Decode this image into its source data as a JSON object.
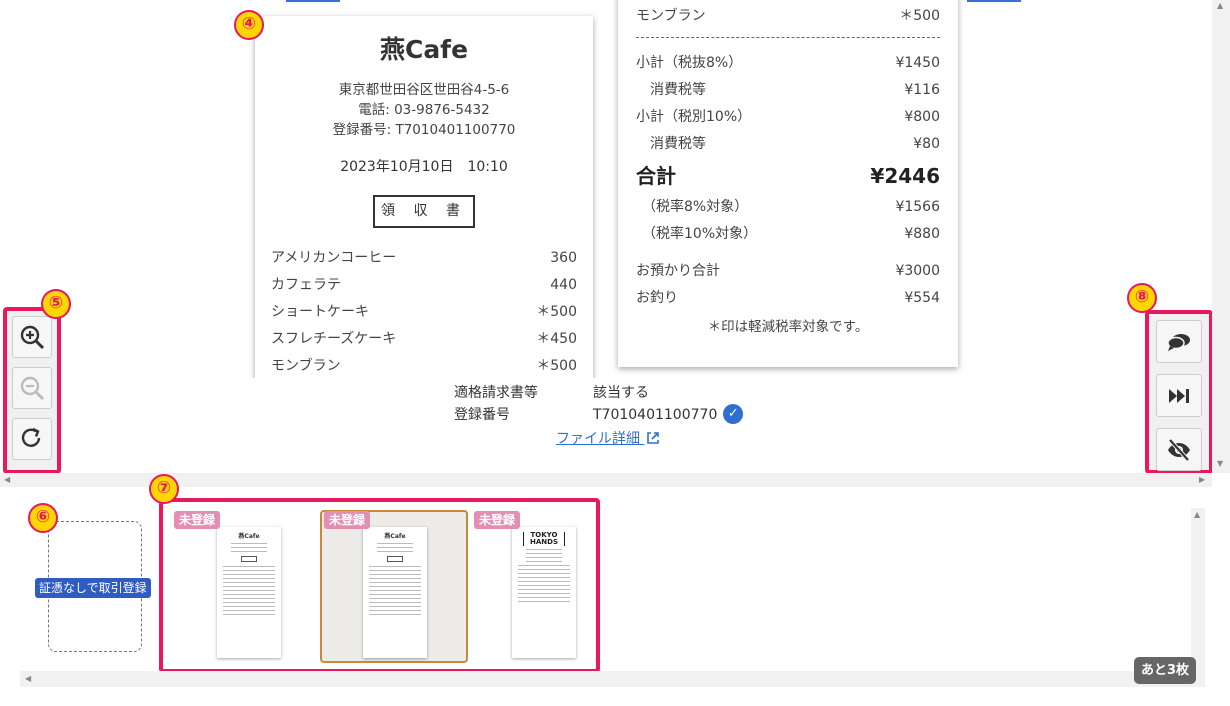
{
  "receipt_left": {
    "shop_name": "燕Cafe",
    "address": "東京都世田谷区世田谷4-5-6",
    "phone": "電話: 03-9876-5432",
    "registration": "登録番号:  T7010401100770",
    "datetime": "2023年10月10日　10:10",
    "title": "領 収 書",
    "items": [
      {
        "name": "アメリカンコーヒー",
        "price": "360"
      },
      {
        "name": "カフェラテ",
        "price": "440"
      },
      {
        "name": "ショートケーキ",
        "price": "＊500"
      },
      {
        "name": "スフレチーズケーキ",
        "price": "＊450"
      },
      {
        "name": "モンブラン",
        "price": "＊500"
      }
    ]
  },
  "receipt_right": {
    "top_item": {
      "name": "モンブラン",
      "price": "＊500"
    },
    "subtotal_8": {
      "label": "小計（税抜8%）",
      "value": "¥1450"
    },
    "tax_8": {
      "label": "消費税等",
      "value": "¥116"
    },
    "subtotal_10": {
      "label": "小計（税別10%）",
      "value": "¥800"
    },
    "tax_10": {
      "label": "消費税等",
      "value": "¥80"
    },
    "total": {
      "label": "合計",
      "value": "¥2446"
    },
    "target_8": {
      "label": "（税率8%対象）",
      "value": "¥1566"
    },
    "target_10": {
      "label": "（税率10%対象）",
      "value": "¥880"
    },
    "deposit": {
      "label": "お預かり合計",
      "value": "¥3000"
    },
    "change": {
      "label": "お釣り",
      "value": "¥554"
    },
    "note": "＊印は軽減税率対象です。"
  },
  "meta": {
    "qualified_label": "適格請求書等",
    "qualified_value": "該当する",
    "reg_label": "登録番号",
    "reg_value": "T7010401100770",
    "file_link": "ファイル詳細"
  },
  "badges": {
    "b4": "④",
    "b5": "⑤",
    "b6": "⑥",
    "b7": "⑦",
    "b8": "⑧"
  },
  "icons": {
    "zoom_in": "zoom-in-icon",
    "zoom_out": "zoom-out-icon",
    "rotate": "rotate-icon",
    "comment": "comment-icon",
    "skip": "skip-next-icon",
    "hide": "eye-off-icon"
  },
  "strip": {
    "no_doc_button": "証憑なしで取引登録",
    "thumbnails": [
      {
        "tag": "未登録",
        "mini_title": "燕Cafe"
      },
      {
        "tag": "未登録",
        "mini_title": "燕Cafe"
      },
      {
        "tag": "未登録",
        "mini_title": "TOKYO HANDS"
      }
    ],
    "remaining": "あと3枚"
  },
  "colors": {
    "highlight": "#e8185f",
    "badge_fill": "#ffd600",
    "accent": "#2f6fd0",
    "tag": "#e38fb3"
  }
}
